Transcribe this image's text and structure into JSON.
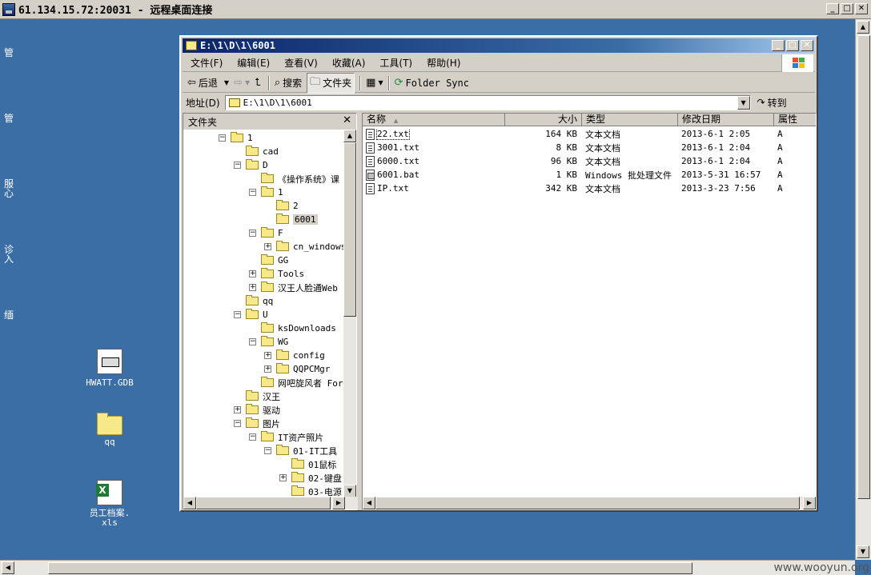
{
  "rdp": {
    "title": "61.134.15.72:20031 - 远程桌面连接",
    "watermark": "www.wooyun.org"
  },
  "desktop": {
    "edge_labels": [
      "管",
      "管",
      "服",
      "心",
      "诊",
      "入",
      "缅"
    ],
    "icons": [
      {
        "name": "HWATT.GDB",
        "icon": "document-icon"
      },
      {
        "name": "qq",
        "icon": "folder-icon"
      },
      {
        "name": "员工档案.\nxls",
        "icon": "excel-icon"
      }
    ]
  },
  "explorer": {
    "title": "E:\\1\\D\\1\\6001",
    "menu": [
      "文件(F)",
      "编辑(E)",
      "查看(V)",
      "收藏(A)",
      "工具(T)",
      "帮助(H)"
    ],
    "toolbar": {
      "back": "后退",
      "search": "搜索",
      "folders": "文件夹",
      "folder_sync": "Folder Sync"
    },
    "address": {
      "label": "地址(D)",
      "value": "E:\\1\\D\\1\\6001",
      "go": "转到"
    },
    "folder_pane": {
      "title": "文件夹",
      "tree": [
        {
          "label": "1",
          "level": 0,
          "exp": "minus"
        },
        {
          "label": "cad",
          "level": 1,
          "exp": "none"
        },
        {
          "label": "D",
          "level": 1,
          "exp": "minus"
        },
        {
          "label": "《操作系统》课",
          "level": 2,
          "exp": "none"
        },
        {
          "label": "1",
          "level": 2,
          "exp": "minus"
        },
        {
          "label": "2",
          "level": 3,
          "exp": "none"
        },
        {
          "label": "6001",
          "level": 3,
          "exp": "none",
          "selected": true
        },
        {
          "label": "F",
          "level": 2,
          "exp": "minus"
        },
        {
          "label": "cn_windows_",
          "level": 3,
          "exp": "plus"
        },
        {
          "label": "GG",
          "level": 2,
          "exp": "none"
        },
        {
          "label": "Tools",
          "level": 2,
          "exp": "plus"
        },
        {
          "label": "汉王人脸通Web",
          "level": 2,
          "exp": "plus"
        },
        {
          "label": "qq",
          "level": 1,
          "exp": "none"
        },
        {
          "label": "U",
          "level": 1,
          "exp": "minus"
        },
        {
          "label": "ksDownloads",
          "level": 2,
          "exp": "none"
        },
        {
          "label": "WG",
          "level": 2,
          "exp": "minus"
        },
        {
          "label": "config",
          "level": 3,
          "exp": "plus"
        },
        {
          "label": "QQPCMgr",
          "level": 3,
          "exp": "plus"
        },
        {
          "label": "网吧旋风者 For",
          "level": 2,
          "exp": "none"
        },
        {
          "label": "汉王",
          "level": 1,
          "exp": "none"
        },
        {
          "label": "驱动",
          "level": 1,
          "exp": "plus"
        },
        {
          "label": "图片",
          "level": 1,
          "exp": "minus"
        },
        {
          "label": "IT资产照片",
          "level": 2,
          "exp": "minus"
        },
        {
          "label": "01-IT工具",
          "level": 3,
          "exp": "minus"
        },
        {
          "label": "01鼠标",
          "level": 4,
          "exp": "none"
        },
        {
          "label": "02-键盘",
          "level": 4,
          "exp": "plus"
        },
        {
          "label": "03-电源",
          "level": 4,
          "exp": "none"
        }
      ]
    },
    "file_list": {
      "columns": [
        "名称",
        "大小",
        "类型",
        "修改日期",
        "属性"
      ],
      "rows": [
        {
          "name": "22.txt",
          "size": "164 KB",
          "type": "文本文档",
          "date": "2013-6-1 2:05",
          "attr": "A",
          "icon": "text",
          "focused": true
        },
        {
          "name": "3001.txt",
          "size": "8 KB",
          "type": "文本文档",
          "date": "2013-6-1 2:04",
          "attr": "A",
          "icon": "text"
        },
        {
          "name": "6000.txt",
          "size": "96 KB",
          "type": "文本文档",
          "date": "2013-6-1 2:04",
          "attr": "A",
          "icon": "text"
        },
        {
          "name": "6001.bat",
          "size": "1 KB",
          "type": "Windows 批处理文件",
          "date": "2013-5-31 16:57",
          "attr": "A",
          "icon": "bat"
        },
        {
          "name": "IP.txt",
          "size": "342 KB",
          "type": "文本文档",
          "date": "2013-3-23 7:56",
          "attr": "A",
          "icon": "text"
        }
      ]
    }
  }
}
